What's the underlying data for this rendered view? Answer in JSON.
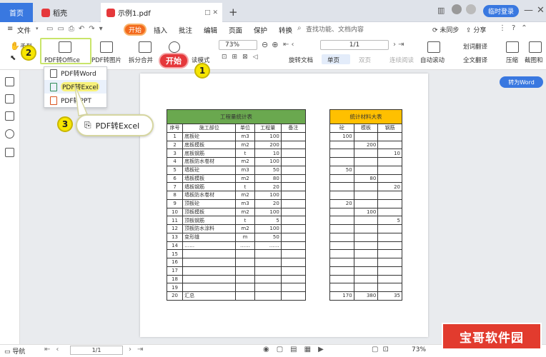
{
  "tabs": {
    "home": "首页",
    "daoke": "稻壳",
    "doc": "示例1.pdf"
  },
  "window": {
    "login": "临时登录"
  },
  "menu": {
    "file": "文件",
    "items": [
      "开始",
      "插入",
      "批注",
      "编辑",
      "页面",
      "保护",
      "转换"
    ],
    "search_placeholder": "查找功能、文档内容",
    "unsaved": "未同步",
    "share": "分享"
  },
  "toolbar": {
    "hand": "手型",
    "pdf_office": "PDF转Office",
    "pdf_image": "PDF转图片",
    "split_merge": "拆分合并",
    "read_mode": "读模式",
    "zoom": "73%",
    "page": "1/1",
    "rotate": "旋转文档",
    "single": "单页",
    "double": "双页",
    "continuous": "连续阅读",
    "auto_scroll": "自动滚动",
    "translate_word": "划词翻译",
    "translate_full": "全文翻译",
    "compress": "压缩",
    "screenshot": "截图和"
  },
  "dropdown": {
    "items": [
      "PDF转Word",
      "PDF转Excel",
      "PDF转PPT"
    ]
  },
  "annotations": {
    "kaishi": "开始",
    "callout": "PDF转Excel",
    "n1": "1",
    "n2": "2",
    "n3": "3"
  },
  "convert_word": "转为Word",
  "table1": {
    "title": "工程量统计表",
    "headers": [
      "序号",
      "施工部位",
      "单位",
      "工程量",
      "备注"
    ],
    "rows": [
      [
        "1",
        "底板砼",
        "m3",
        "100",
        ""
      ],
      [
        "2",
        "底板模板",
        "m2",
        "200",
        ""
      ],
      [
        "3",
        "底板钢筋",
        "t",
        "10",
        ""
      ],
      [
        "4",
        "底板防水卷材",
        "m2",
        "100",
        ""
      ],
      [
        "5",
        "墙板砼",
        "m3",
        "50",
        ""
      ],
      [
        "6",
        "墙板模板",
        "m2",
        "80",
        ""
      ],
      [
        "7",
        "墙板钢筋",
        "t",
        "20",
        ""
      ],
      [
        "8",
        "墙板防水卷材",
        "m2",
        "100",
        ""
      ],
      [
        "9",
        "顶板砼",
        "m3",
        "20",
        ""
      ],
      [
        "10",
        "顶板模板",
        "m2",
        "100",
        ""
      ],
      [
        "11",
        "顶板钢筋",
        "t",
        "5",
        ""
      ],
      [
        "12",
        "顶板防水涂料",
        "m2",
        "100",
        ""
      ],
      [
        "13",
        "变形缝",
        "m",
        "50",
        ""
      ],
      [
        "14",
        "……",
        "……",
        "……",
        ""
      ],
      [
        "15",
        "",
        "",
        "",
        ""
      ],
      [
        "16",
        "",
        "",
        "",
        ""
      ],
      [
        "17",
        "",
        "",
        "",
        ""
      ],
      [
        "18",
        "",
        "",
        "",
        ""
      ],
      [
        "19",
        "",
        "",
        "",
        ""
      ],
      [
        "20",
        "汇总",
        "",
        "",
        ""
      ]
    ]
  },
  "table2": {
    "title": "统计材料大表",
    "headers": [
      "砼",
      "模板",
      "钢筋"
    ],
    "rows": [
      [
        "100",
        "",
        ""
      ],
      [
        "",
        "200",
        ""
      ],
      [
        "",
        "",
        "10"
      ],
      [
        "",
        "",
        ""
      ],
      [
        "50",
        "",
        ""
      ],
      [
        "",
        "80",
        ""
      ],
      [
        "",
        "",
        "20"
      ],
      [
        "",
        "",
        ""
      ],
      [
        "20",
        "",
        ""
      ],
      [
        "",
        "100",
        ""
      ],
      [
        "",
        "",
        "5"
      ],
      [
        "",
        "",
        ""
      ],
      [
        "",
        "",
        ""
      ],
      [
        "",
        "",
        ""
      ],
      [
        "",
        "",
        ""
      ],
      [
        "",
        "",
        ""
      ],
      [
        "",
        "",
        ""
      ],
      [
        "",
        "",
        ""
      ],
      [
        "",
        "",
        ""
      ],
      [
        "170",
        "380",
        "35"
      ]
    ]
  },
  "status": {
    "nav": "导航",
    "page": "1/1",
    "zoom": "73%"
  },
  "watermark": "宝哥软件园",
  "colors": {
    "table1_header": "#6aa84f",
    "table2_header": "#ffc000",
    "accent": "#3978e0",
    "kaishi": "#f36a1d"
  }
}
